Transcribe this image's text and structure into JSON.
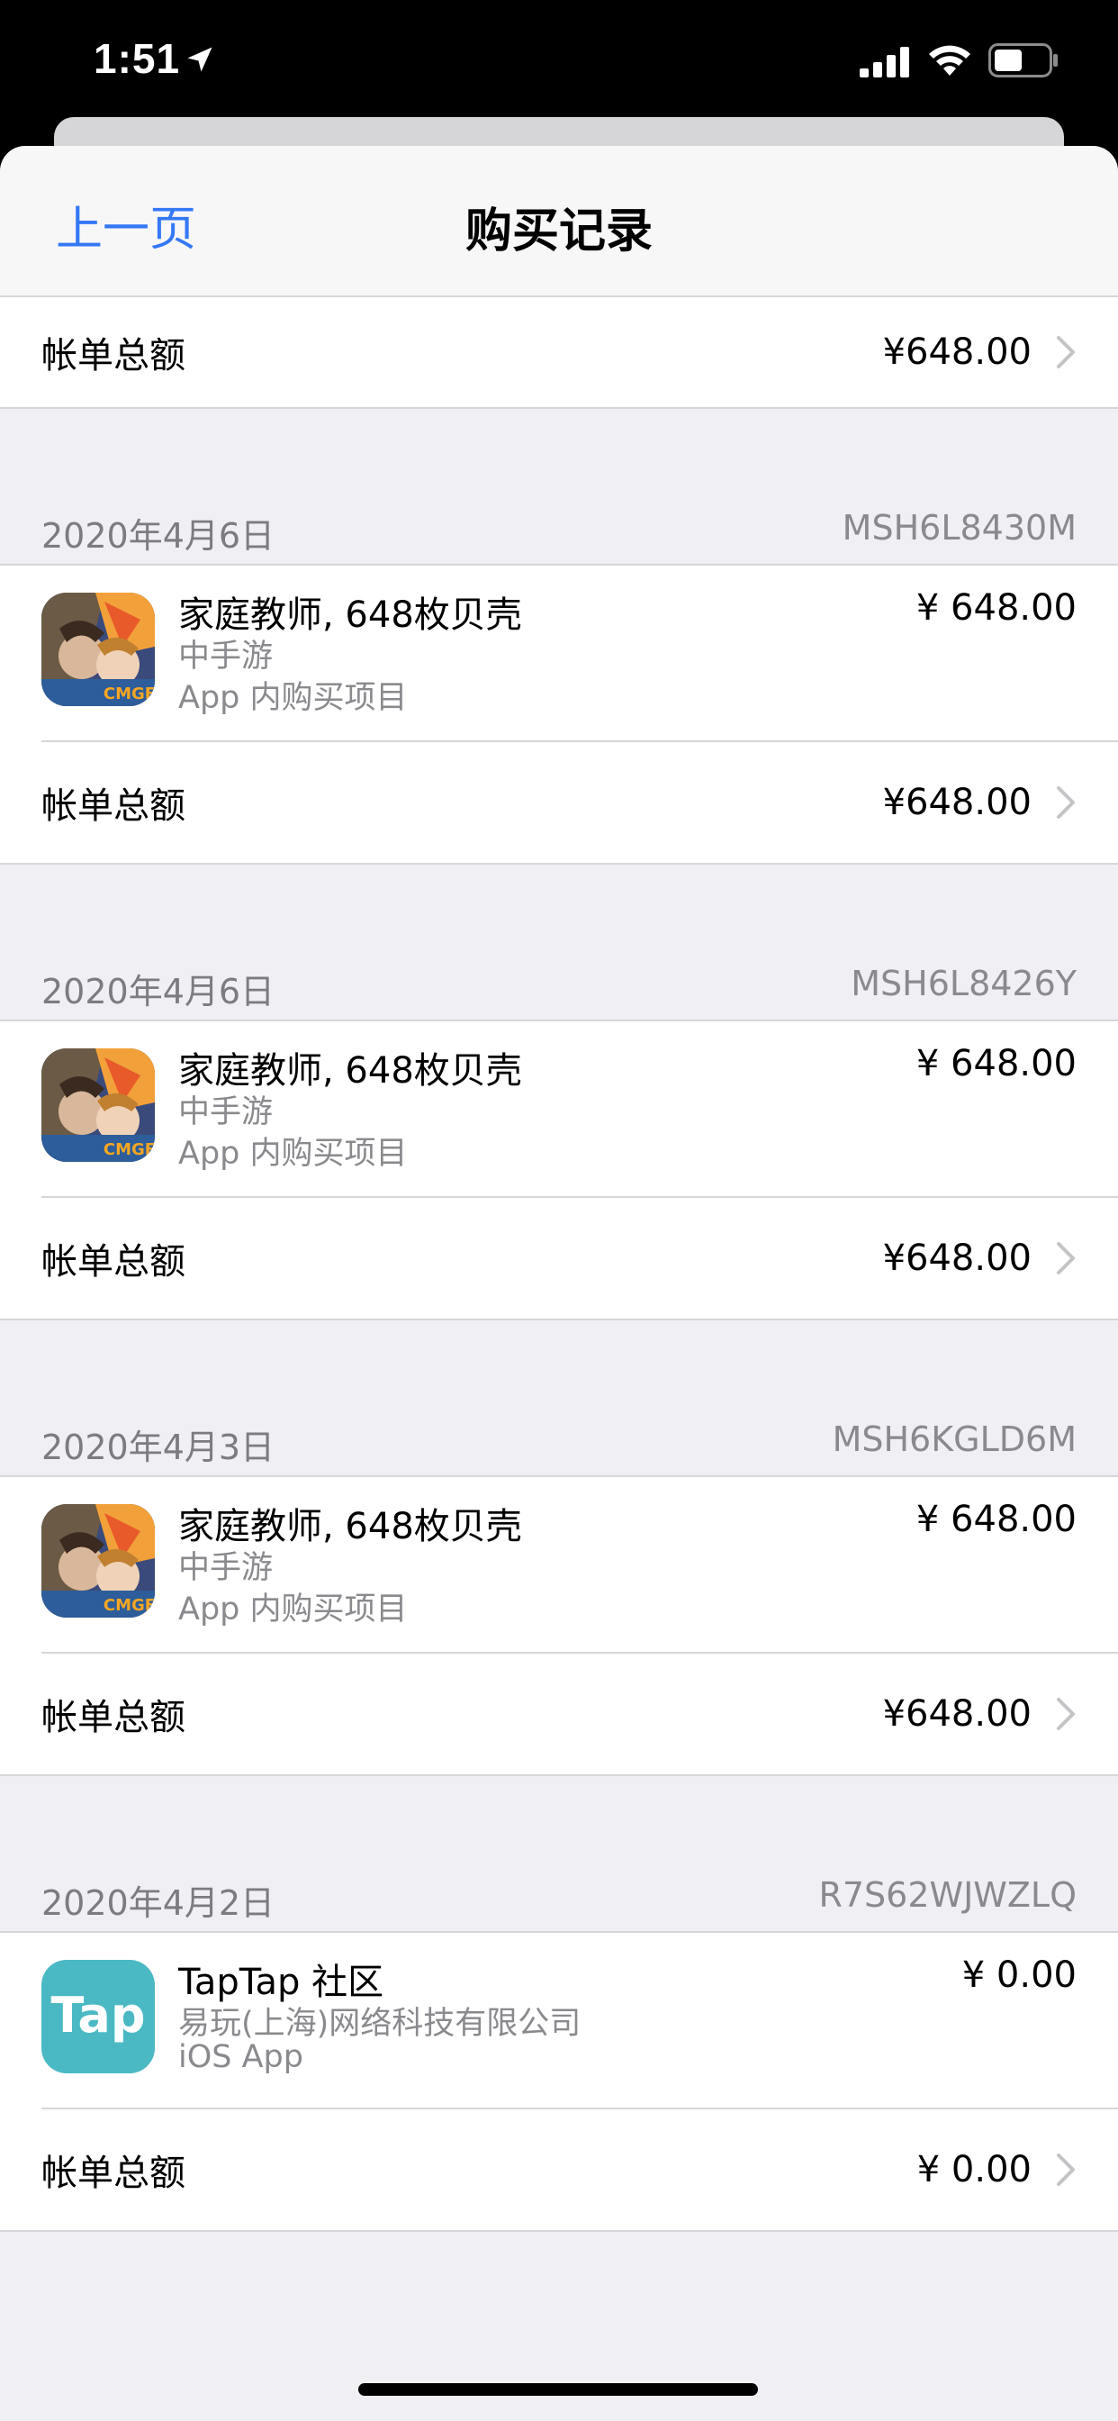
{
  "status_bar": {
    "time": "1:51"
  },
  "nav": {
    "back_label": "上一页",
    "title": "购买记录"
  },
  "first_total": {
    "label": "帐单总额",
    "amount": "¥648.00"
  },
  "sections": [
    {
      "date": "2020年4月6日",
      "order_id": "MSH6L8430M",
      "item": {
        "title": "家庭教师, 648枚贝壳",
        "developer": "中手游",
        "type": "App 内购买项目",
        "price": "¥ 648.00",
        "icon": "reborn-game-icon"
      },
      "total": {
        "label": "帐单总额",
        "amount": "¥648.00"
      }
    },
    {
      "date": "2020年4月6日",
      "order_id": "MSH6L8426Y",
      "item": {
        "title": "家庭教师, 648枚贝壳",
        "developer": "中手游",
        "type": "App 内购买项目",
        "price": "¥ 648.00",
        "icon": "reborn-game-icon"
      },
      "total": {
        "label": "帐单总额",
        "amount": "¥648.00"
      }
    },
    {
      "date": "2020年4月3日",
      "order_id": "MSH6KGLD6M",
      "item": {
        "title": "家庭教师, 648枚贝壳",
        "developer": "中手游",
        "type": "App 内购买项目",
        "price": "¥ 648.00",
        "icon": "reborn-game-icon"
      },
      "total": {
        "label": "帐单总额",
        "amount": "¥648.00"
      }
    },
    {
      "date": "2020年4月2日",
      "order_id": "R7S62WJWZLQ",
      "item": {
        "title": "TapTap 社区",
        "developer": "易玩(上海)网络科技有限公司",
        "type": "iOS App",
        "price": "¥ 0.00",
        "icon": "taptap-icon"
      },
      "total": {
        "label": "帐单总额",
        "amount": "¥ 0.00"
      }
    }
  ],
  "icons": {
    "game_badge_text": "CMGF",
    "taptap_text": "Tap"
  },
  "colors": {
    "accent": "#3478f6",
    "taptap": "#4ab9c4",
    "background": "#efeff4"
  }
}
